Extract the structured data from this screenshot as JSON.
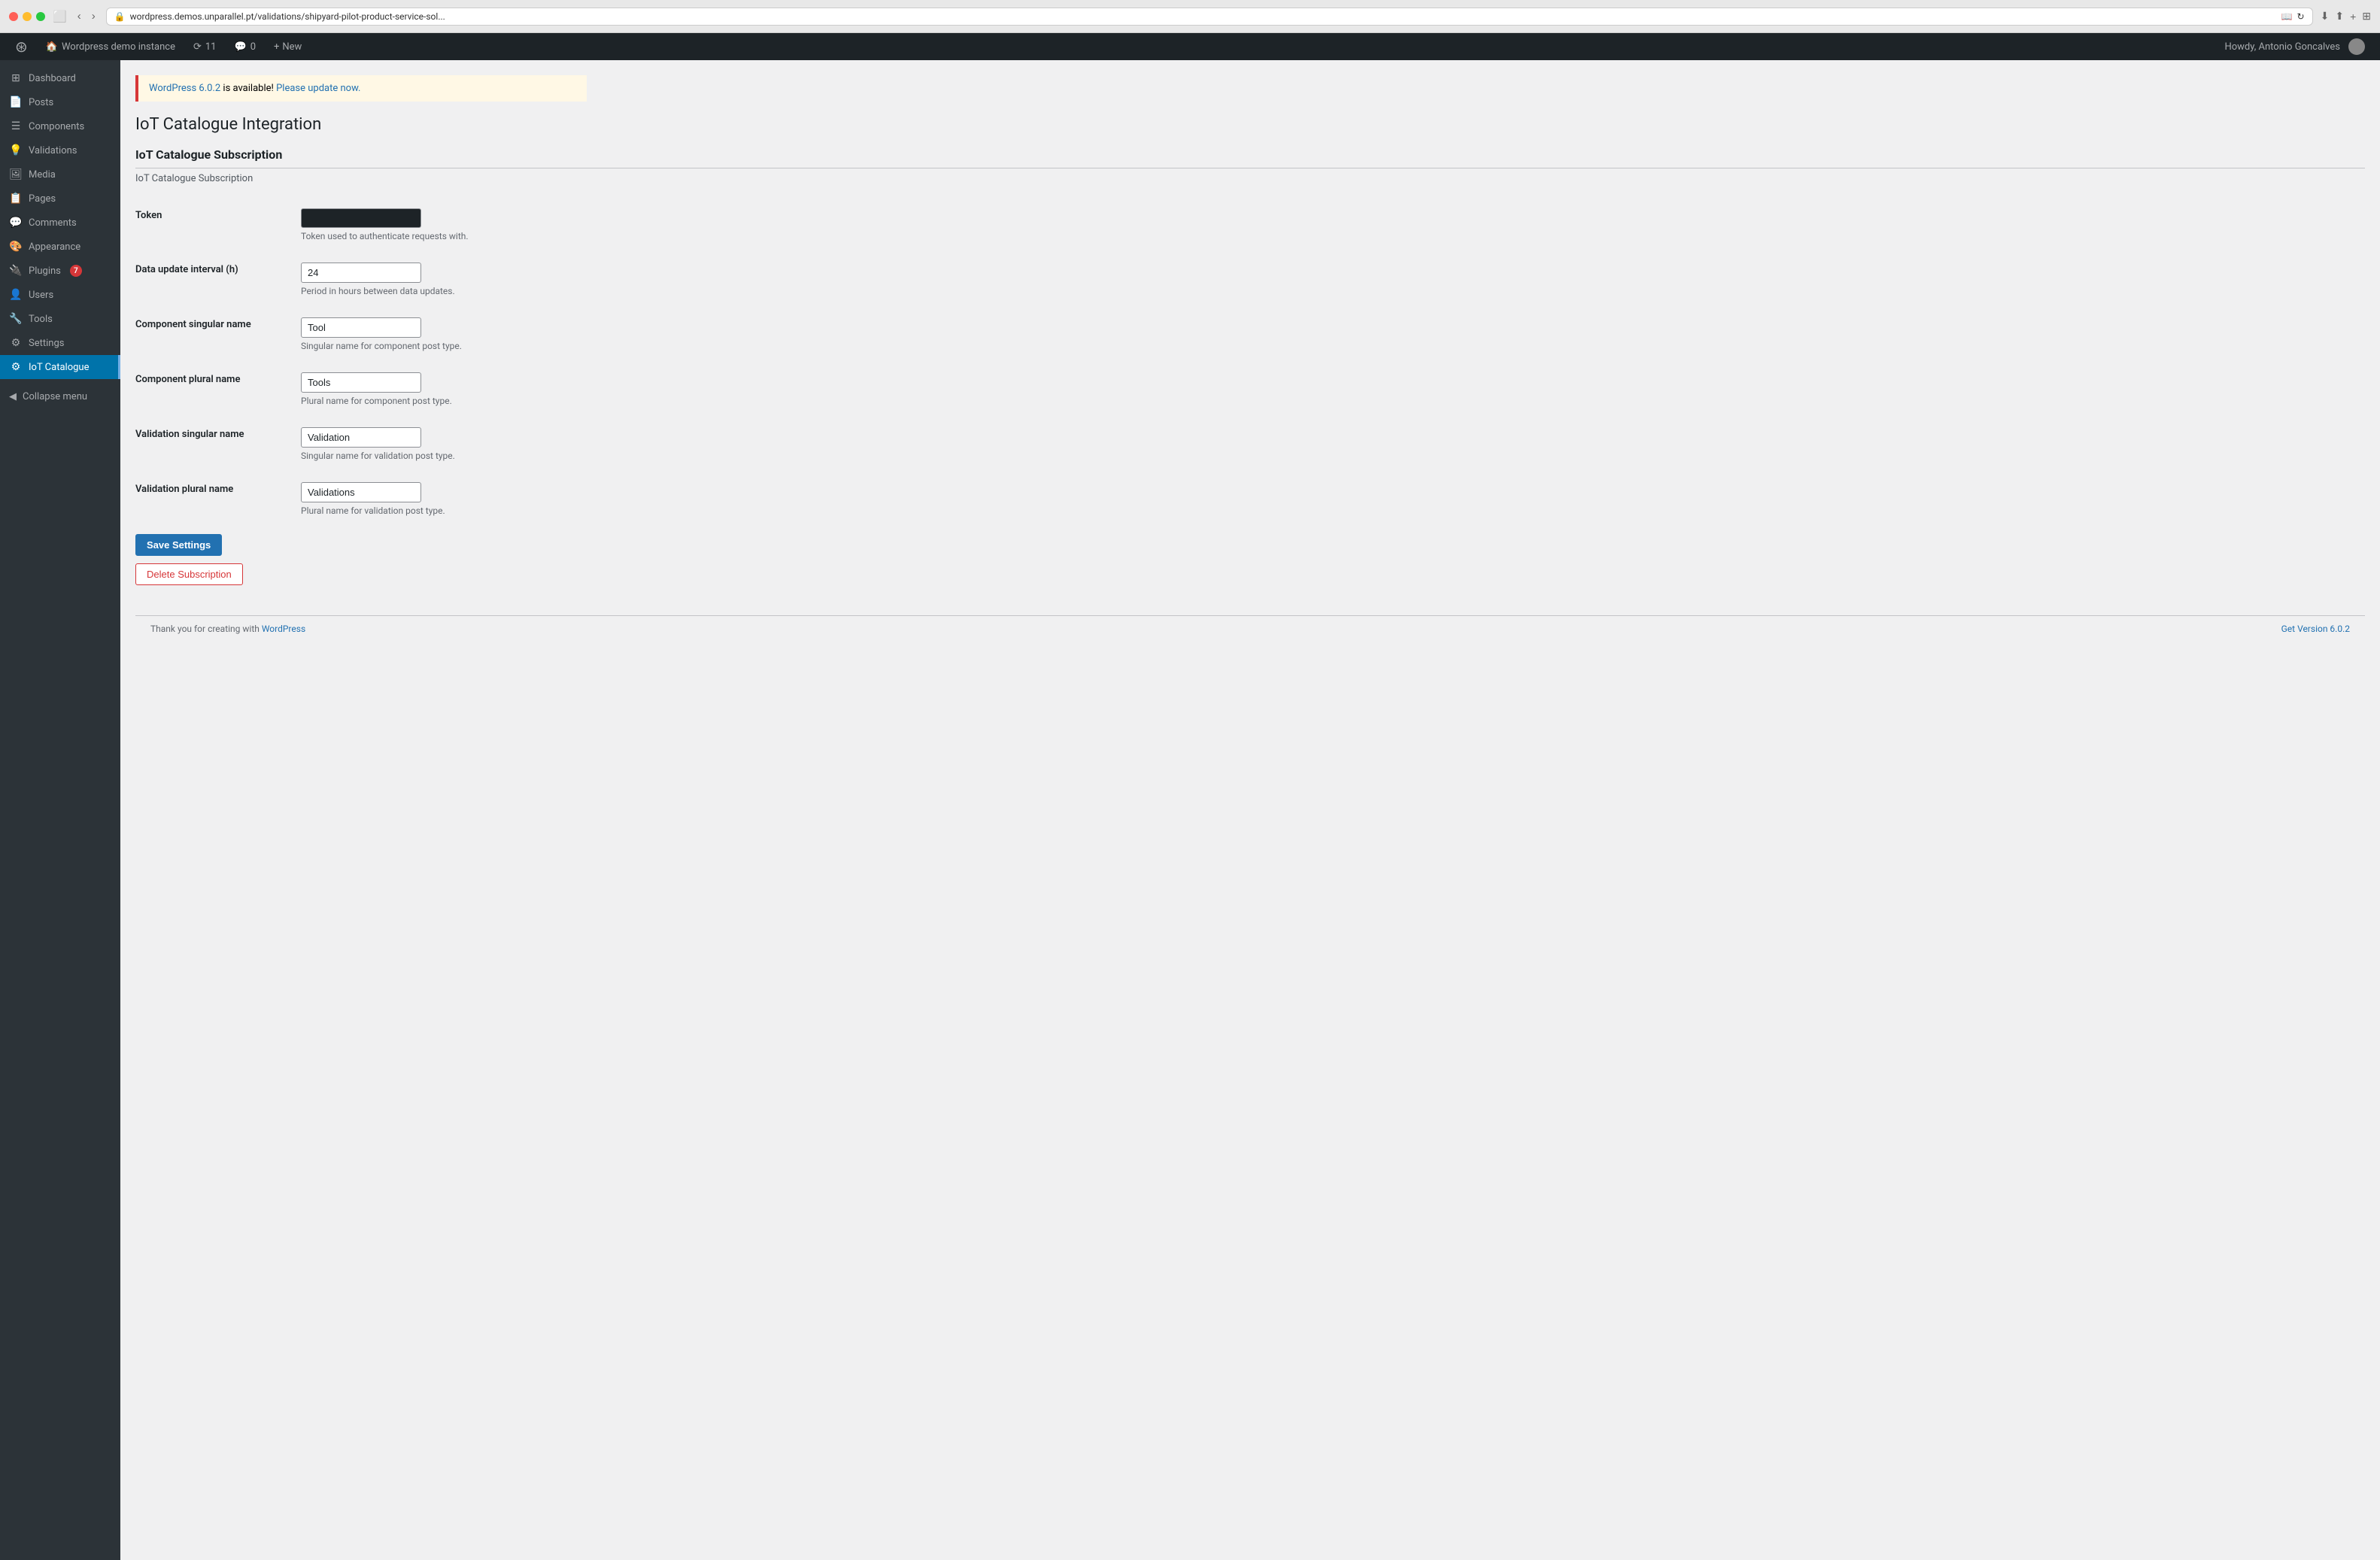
{
  "browser": {
    "url": "wordpress.demos.unparallel.pt/validations/shipyard-pilot-product-service-sol...",
    "back_disabled": false,
    "forward_disabled": false
  },
  "admin_bar": {
    "logo_label": "WordPress",
    "site_name": "Wordpress demo instance",
    "updates_count": "11",
    "comments_count": "0",
    "new_label": "New",
    "howdy_label": "Howdy, Antonio Goncalves"
  },
  "sidebar": {
    "items": [
      {
        "id": "dashboard",
        "label": "Dashboard",
        "icon": "⊞",
        "active": false
      },
      {
        "id": "posts",
        "label": "Posts",
        "icon": "📄",
        "active": false
      },
      {
        "id": "components",
        "label": "Components",
        "icon": "☰",
        "active": false
      },
      {
        "id": "validations",
        "label": "Validations",
        "icon": "💡",
        "active": false
      },
      {
        "id": "media",
        "label": "Media",
        "icon": "🖼",
        "active": false
      },
      {
        "id": "pages",
        "label": "Pages",
        "icon": "📋",
        "active": false
      },
      {
        "id": "comments",
        "label": "Comments",
        "icon": "💬",
        "active": false
      },
      {
        "id": "appearance",
        "label": "Appearance",
        "icon": "🎨",
        "active": false
      },
      {
        "id": "plugins",
        "label": "Plugins",
        "icon": "🔌",
        "active": false,
        "badge": "7"
      },
      {
        "id": "users",
        "label": "Users",
        "icon": "👤",
        "active": false
      },
      {
        "id": "tools",
        "label": "Tools",
        "icon": "🔧",
        "active": false
      },
      {
        "id": "settings",
        "label": "Settings",
        "icon": "⚙",
        "active": false
      },
      {
        "id": "iot-catalogue",
        "label": "IoT Catalogue",
        "icon": "⚙",
        "active": true
      }
    ],
    "collapse_label": "Collapse menu"
  },
  "update_notice": {
    "version_link_text": "WordPress 6.0.2",
    "message": " is available! ",
    "update_link_text": "Please update now."
  },
  "page": {
    "title": "IoT Catalogue Integration",
    "section_title": "IoT Catalogue Subscription",
    "section_desc": "IoT Catalogue Subscription",
    "fields": [
      {
        "id": "token",
        "label": "Token",
        "value": "",
        "type": "token",
        "description": "Token used to authenticate requests with."
      },
      {
        "id": "data_update_interval",
        "label": "Data update interval (h)",
        "value": "24",
        "type": "text",
        "description": "Period in hours between data updates."
      },
      {
        "id": "component_singular",
        "label": "Component singular name",
        "value": "Tool",
        "type": "text",
        "description": "Singular name for component post type."
      },
      {
        "id": "component_plural",
        "label": "Component plural name",
        "value": "Tools",
        "type": "text",
        "description": "Plural name for component post type."
      },
      {
        "id": "validation_singular",
        "label": "Validation singular name",
        "value": "Validation",
        "type": "text",
        "description": "Singular name for validation post type."
      },
      {
        "id": "validation_plural",
        "label": "Validation plural name",
        "value": "Validations",
        "type": "text",
        "description": "Plural name for validation post type."
      }
    ],
    "save_button": "Save Settings",
    "delete_button": "Delete Subscription"
  },
  "footer": {
    "thank_you_text": "Thank you for creating with ",
    "wp_link": "WordPress",
    "version_label": "Get Version 6.0.2"
  }
}
